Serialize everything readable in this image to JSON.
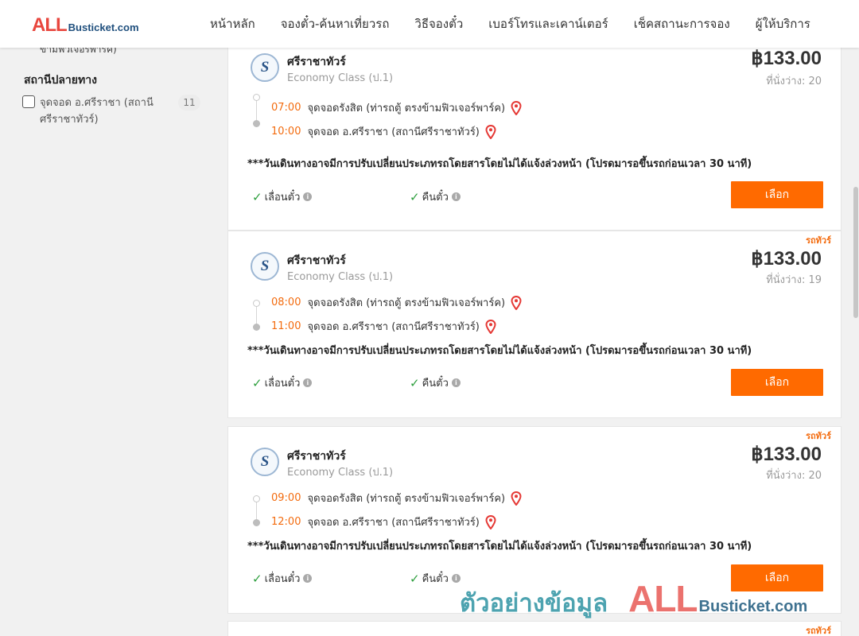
{
  "brand": {
    "all": "ALL",
    "rest": "Busticket.com"
  },
  "nav": [
    "หน้าหลัก",
    "จองตั๋ว-ค้นหาเที่ยวรถ",
    "วิธีจองตั๋ว",
    "เบอร์โทรและเคาน์เตอร์",
    "เช็คสถานะการจอง",
    "ผู้ให้บริการ"
  ],
  "sidebar": {
    "cut_text": "ข้ามฟิวเจอร์พาร์ค)",
    "filter_title": "สถานีปลายทาง",
    "filter_item": {
      "label": "จุดจอด อ.ศรีราชา (สถานีศรีราชาทัวร์)",
      "count": "11",
      "checked": false
    }
  },
  "cards": [
    {
      "tag": "",
      "operator": "ศรีราชาทัวร์",
      "class": "Economy Class (ป.1)",
      "price": "฿133.00",
      "seats": "ที่นั่งว่าง: 20",
      "depart_time": "07:00",
      "depart_stop": "จุดจอดรังสิต (ท่ารถตู้ ตรงข้ามฟิวเจอร์พาร์ค)",
      "arrive_time": "10:00",
      "arrive_stop": "จุดจอด อ.ศรีราชา (สถานีศรีราชาทัวร์)",
      "note": "***วันเดินทางอาจมีการปรับเปลี่ยนประเภทรถโดยสารโดยไม่ได้แจ้งล่วงหน้า (โปรดมารอขึ้นรถก่อนเวลา 30 นาที)",
      "feature1": "เลื่อนตั๋ว",
      "feature2": "คืนตั๋ว",
      "button": "เลือก"
    },
    {
      "tag": "รถทัวร์",
      "operator": "ศรีราชาทัวร์",
      "class": "Economy Class (ป.1)",
      "price": "฿133.00",
      "seats": "ที่นั่งว่าง: 19",
      "depart_time": "08:00",
      "depart_stop": "จุดจอดรังสิต (ท่ารถตู้ ตรงข้ามฟิวเจอร์พาร์ค)",
      "arrive_time": "11:00",
      "arrive_stop": "จุดจอด อ.ศรีราชา (สถานีศรีราชาทัวร์)",
      "note": "***วันเดินทางอาจมีการปรับเปลี่ยนประเภทรถโดยสารโดยไม่ได้แจ้งล่วงหน้า (โปรดมารอขึ้นรถก่อนเวลา 30 นาที)",
      "feature1": "เลื่อนตั๋ว",
      "feature2": "คืนตั๋ว",
      "button": "เลือก"
    },
    {
      "tag": "รถทัวร์",
      "operator": "ศรีราชาทัวร์",
      "class": "Economy Class (ป.1)",
      "price": "฿133.00",
      "seats": "ที่นั่งว่าง: 20",
      "depart_time": "09:00",
      "depart_stop": "จุดจอดรังสิต (ท่ารถตู้ ตรงข้ามฟิวเจอร์พาร์ค)",
      "arrive_time": "12:00",
      "arrive_stop": "จุดจอด อ.ศรีราชา (สถานีศรีราชาทัวร์)",
      "note": "***วันเดินทางอาจมีการปรับเปลี่ยนประเภทรถโดยสารโดยไม่ได้แจ้งล่วงหน้า (โปรดมารอขึ้นรถก่อนเวลา 30 นาที)",
      "feature1": "เลื่อนตั๋ว",
      "feature2": "คืนตั๋ว",
      "button": "เลือก"
    },
    {
      "tag": "รถทัวร์"
    }
  ],
  "watermark": {
    "thai": "ตัวอย่างข้อมูล",
    "all": "ALL",
    "rest": "Busticket.com"
  },
  "colors": {
    "accent": "#ff6a00",
    "time": "#f36b0e",
    "check": "#2e9f3e",
    "pin": "#e53935"
  }
}
